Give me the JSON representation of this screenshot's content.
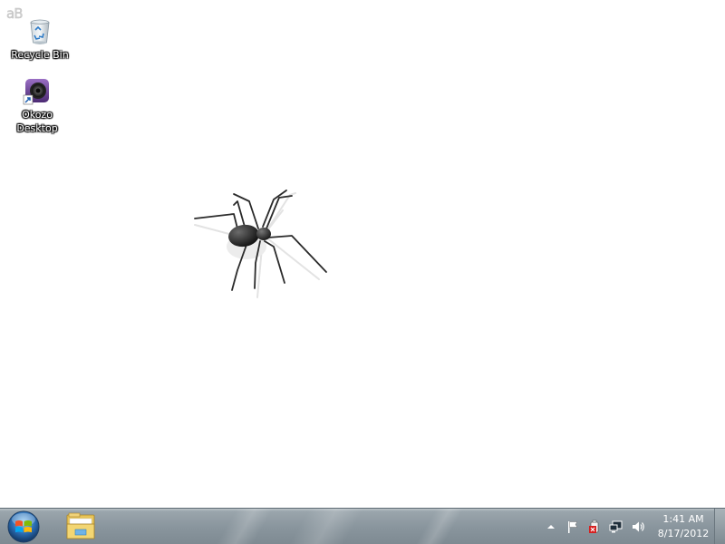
{
  "desktop": {
    "watermark": "aB",
    "icons": [
      {
        "label": "Recycle Bin",
        "icon": "recycle-bin-icon"
      },
      {
        "label": "Okozo Desktop",
        "icon": "okozo-icon"
      }
    ],
    "background_color": "#ffffff"
  },
  "taskbar": {
    "start_icon": "windows-logo-icon",
    "pinned": [
      {
        "name": "Windows Explorer",
        "icon": "folder-icon"
      }
    ],
    "tray": {
      "icons": [
        "show-hidden-icons",
        "action-center-flag-icon",
        "power-icon",
        "network-icon",
        "volume-icon"
      ]
    },
    "clock": {
      "time": "1:41 AM",
      "date": "8/17/2012"
    }
  }
}
